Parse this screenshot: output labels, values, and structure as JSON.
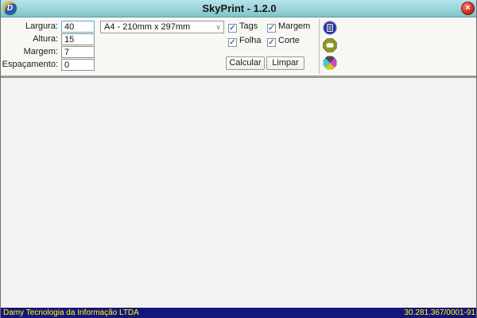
{
  "window": {
    "title": "SkyPrint - 1.2.0"
  },
  "icons": {
    "close": "×",
    "chevron_down": "∨",
    "check": "✓",
    "app_letter": "D"
  },
  "form": {
    "fields": [
      {
        "label": "Largura:",
        "value": "40"
      },
      {
        "label": "Altura:",
        "value": "15"
      },
      {
        "label": "Margem:",
        "value": "7"
      },
      {
        "label": "Espaçamento:",
        "value": "0"
      }
    ],
    "paper_format": "A4 - 210mm x 297mm",
    "checkboxes": [
      {
        "label": "Tags",
        "checked": true
      },
      {
        "label": "Margem",
        "checked": true
      },
      {
        "label": "Folha",
        "checked": true
      },
      {
        "label": "Corte",
        "checked": true
      }
    ],
    "calcular_label": "Calcular",
    "limpar_label": "Limpar"
  },
  "toolbar": {
    "icons": [
      "document-icon",
      "label-icon",
      "colors-icon"
    ]
  },
  "statusbar": {
    "company": "Damy Tecnologia da Informação LTDA",
    "cnpj": "30.281.367/0001-91"
  },
  "colors": {
    "titlebar_top": "#b5e4ea",
    "titlebar_bottom": "#7cc3c7",
    "close_red": "#d62b1f",
    "panel_bg": "#f7f7f4",
    "main_bg": "#f2f2f0",
    "statusbar_bg": "#15157d",
    "statusbar_text": "#ffff00",
    "check_blue": "#2a7ad2",
    "focus_border": "#66a7da"
  }
}
